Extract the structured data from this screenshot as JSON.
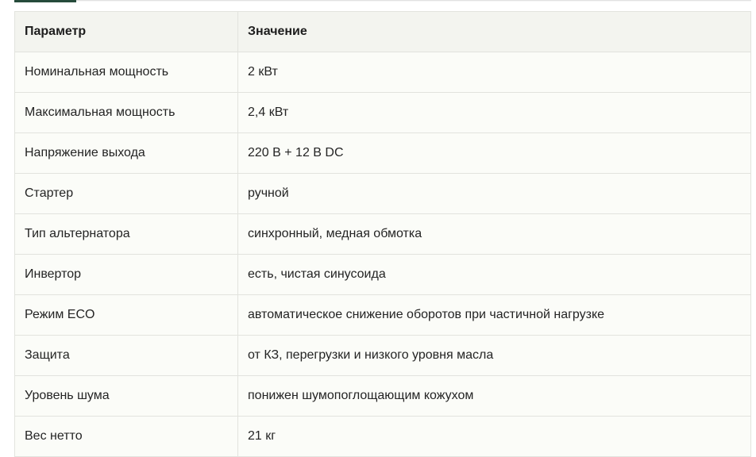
{
  "table": {
    "headers": [
      "Параметр",
      "Значение"
    ],
    "rows": [
      [
        "Номинальная мощность",
        "2 кВт"
      ],
      [
        "Максимальная мощность",
        "2,4 кВт"
      ],
      [
        "Напряжение выхода",
        "220 В + 12 В DC"
      ],
      [
        "Стартер",
        "ручной"
      ],
      [
        "Тип альтернатора",
        "синхронный, медная обмотка"
      ],
      [
        "Инвертор",
        "есть, чистая синусоида"
      ],
      [
        "Режим ECO",
        "автоматическое снижение оборотов при частичной нагрузке"
      ],
      [
        "Защита",
        "от КЗ, перегрузки и низкого уровня масла"
      ],
      [
        "Уровень шума",
        "понижен шумопоглощающим кожухом"
      ],
      [
        "Вес нетто",
        "21 кг"
      ]
    ]
  }
}
